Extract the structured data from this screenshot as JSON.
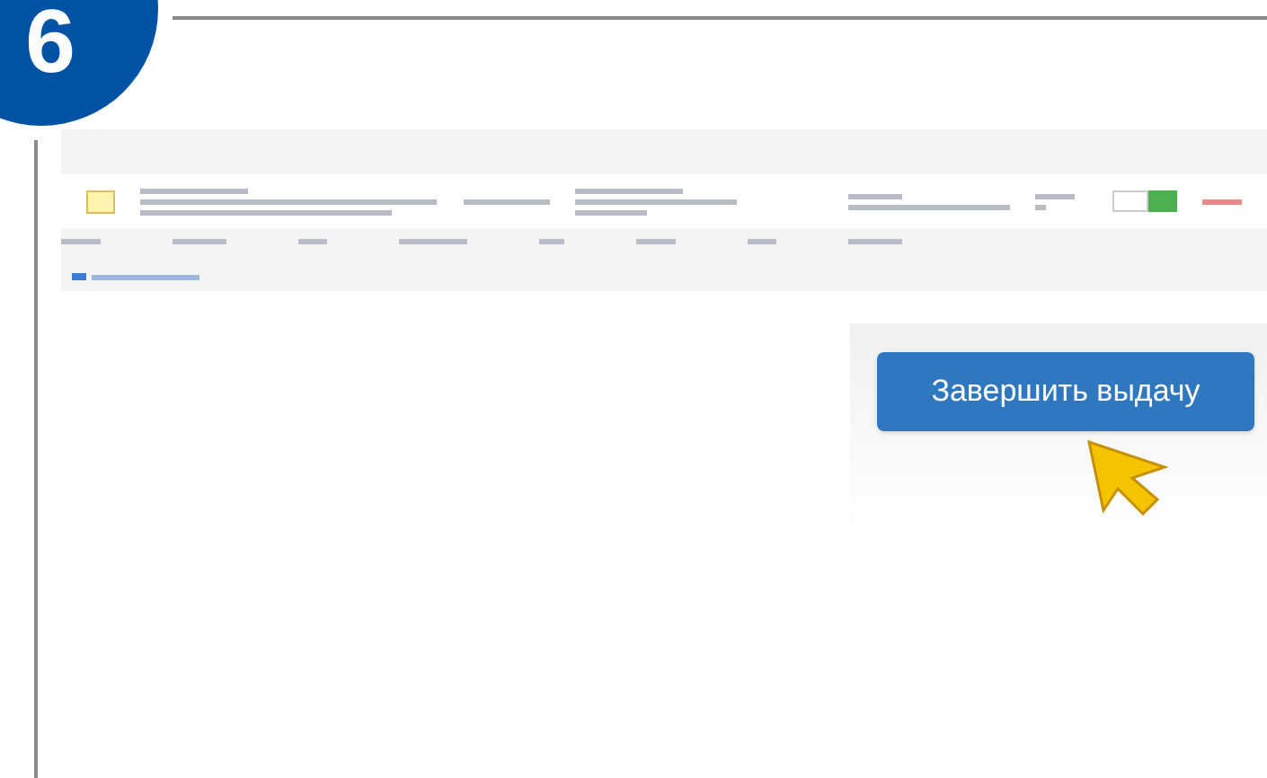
{
  "step": {
    "number": "6"
  },
  "finish_button": {
    "label": "Завершить выдачу"
  }
}
